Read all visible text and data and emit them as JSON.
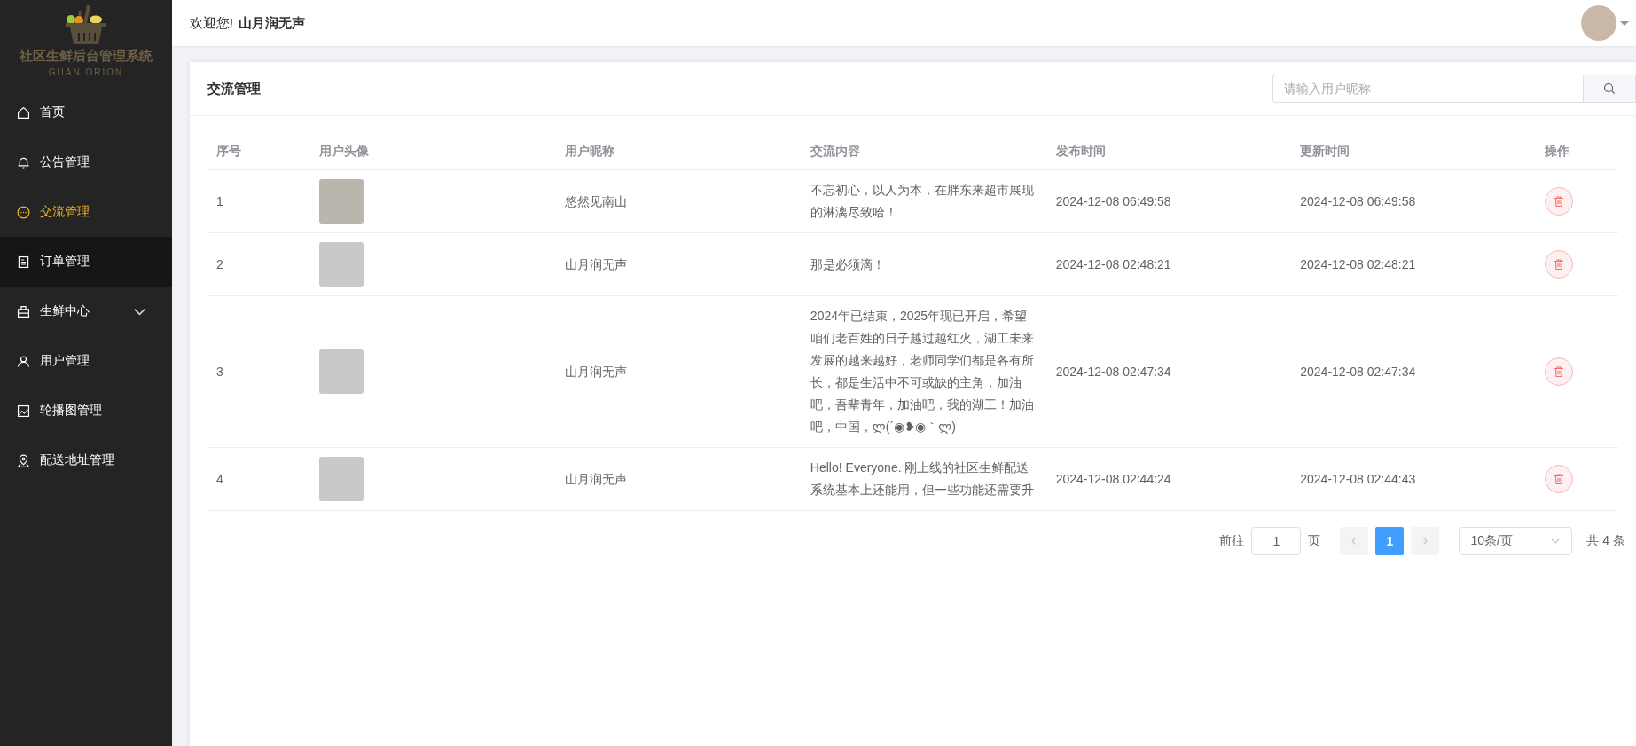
{
  "sidebar": {
    "logo": {
      "title": "社区生鲜后台管理系统",
      "subtitle": "GUAN ORION"
    },
    "items": [
      {
        "label": "首页",
        "selected": false,
        "hovered": false
      },
      {
        "label": "公告管理",
        "selected": false,
        "hovered": false
      },
      {
        "label": "交流管理",
        "selected": true,
        "hovered": false
      },
      {
        "label": "订单管理",
        "selected": false,
        "hovered": true
      },
      {
        "label": "生鲜中心",
        "selected": false,
        "hovered": false,
        "expanded": false
      },
      {
        "label": "用户管理",
        "selected": false,
        "hovered": false
      },
      {
        "label": "轮播图管理",
        "selected": false,
        "hovered": false
      },
      {
        "label": "配送地址管理",
        "selected": false,
        "hovered": false
      }
    ]
  },
  "header": {
    "greeting": "欢迎您!",
    "username": "山月润无声"
  },
  "card": {
    "title": "交流管理",
    "search": {
      "placeholder": "请输入用户昵称"
    }
  },
  "table": {
    "columns": [
      "序号",
      "用户头像",
      "用户昵称",
      "交流内容",
      "发布时间",
      "更新时间",
      "操作"
    ],
    "rows": [
      {
        "index": "1",
        "nickname": "悠然见南山",
        "content": "不忘初心，以人为本，在胖东来超市展现的淋漓尽致哈！",
        "published": "2024-12-08 06:49:58",
        "updated": "2024-12-08 06:49:58"
      },
      {
        "index": "2",
        "nickname": "山月润无声",
        "content": "那是必须滴！",
        "published": "2024-12-08 02:48:21",
        "updated": "2024-12-08 02:48:21"
      },
      {
        "index": "3",
        "nickname": "山月润无声",
        "content": "2024年已结束，2025年现已开启，希望咱们老百姓的日子越过越红火，湖工未来发展的越来越好，老师同学们都是各有所长，都是生活中不可或缺的主角，加油吧，吾辈青年，加油吧，我的湖工！加油吧，中国，ლ(´◉❥◉｀ლ)",
        "published": "2024-12-08 02:47:34",
        "updated": "2024-12-08 02:47:34"
      },
      {
        "index": "4",
        "nickname": "山月润无声",
        "content": "Hello! Everyone. 刚上线的社区生鲜配送系统基本上还能用，但一些功能还需要升",
        "published": "2024-12-08 02:44:24",
        "updated": "2024-12-08 02:44:43"
      }
    ]
  },
  "pagination": {
    "goto_label": "前往",
    "goto_value": "1",
    "page_label": "页",
    "pages": [
      {
        "label": "1",
        "selected": true
      }
    ],
    "page_size": "10条/页",
    "total": "共 4 条"
  }
}
